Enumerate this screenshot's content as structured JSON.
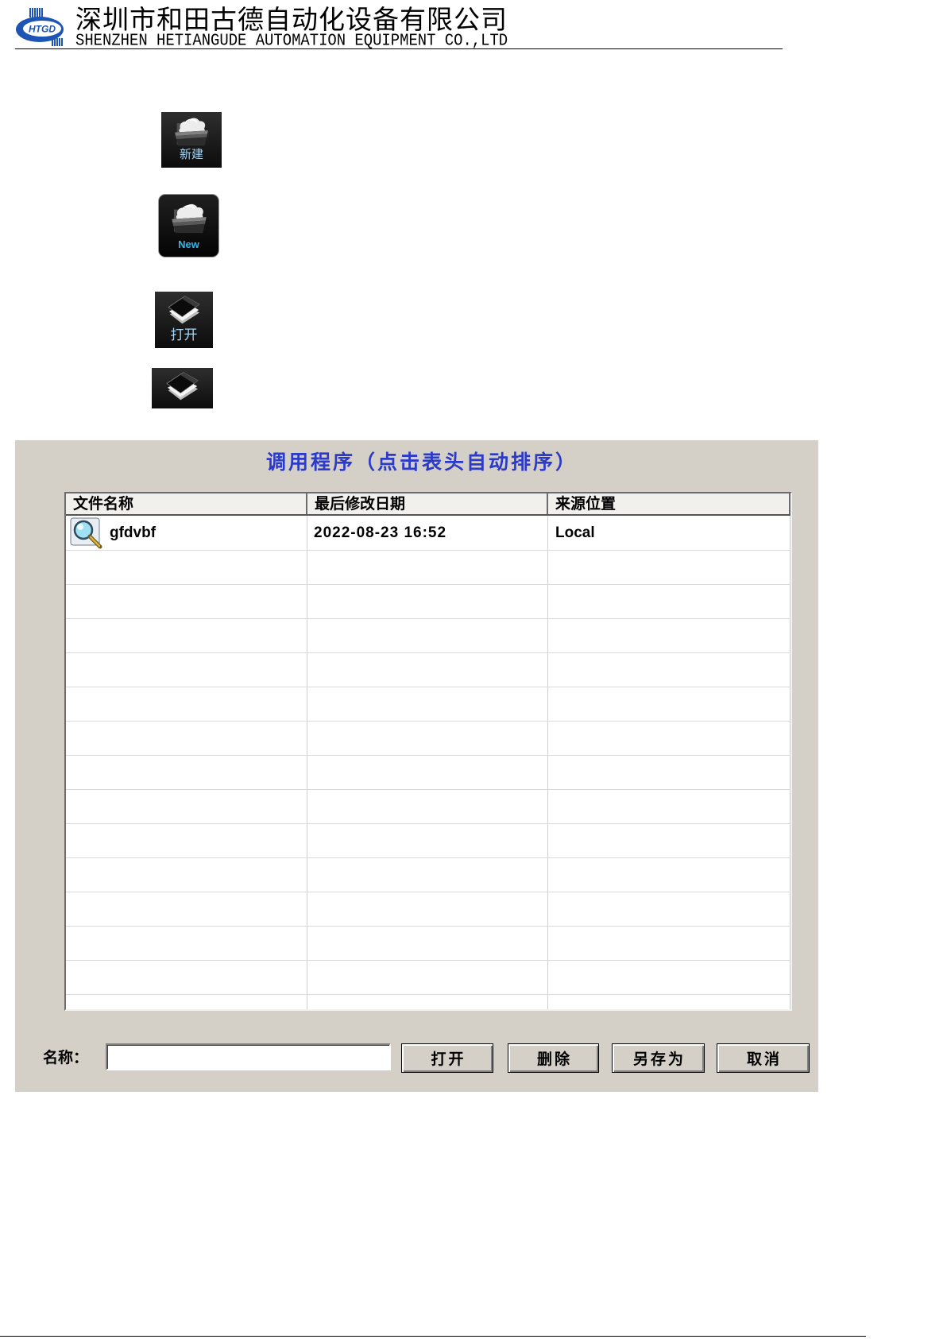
{
  "header": {
    "logo_text": "HTGD",
    "company_name_cn": "深圳市和田古德自动化设备有限公司",
    "company_name_en": "SHENZHEN HETIANGUDE AUTOMATION EQUIPMENT CO.,LTD"
  },
  "toolbar_icons": [
    {
      "icon": "new-folder-icon",
      "label": "新建"
    },
    {
      "icon": "new-folder-icon",
      "label": "New"
    },
    {
      "icon": "open-book-icon",
      "label": "打开"
    },
    {
      "icon": "open-book-icon"
    }
  ],
  "dialog": {
    "title": "调用程序（点击表头自动排序）",
    "columns": [
      "文件名称",
      "最后修改日期",
      "来源位置"
    ],
    "rows": [
      {
        "icon": "magnifier-icon",
        "name": "gfdvbf",
        "modified": "2022-08-23 16:52",
        "source": "Local"
      }
    ],
    "name_label": "名称：",
    "name_value": "",
    "buttons": {
      "open": "打开",
      "delete": "删除",
      "save_as": "另存为",
      "cancel": "取消"
    }
  },
  "colors": {
    "title_text": "#2b3ac9",
    "dialog_background": "#d4d0c8",
    "logo_blue": "#1d55b5",
    "icon_label_cn": "#a9d5f2",
    "icon_label_new": "#35b6e8"
  }
}
